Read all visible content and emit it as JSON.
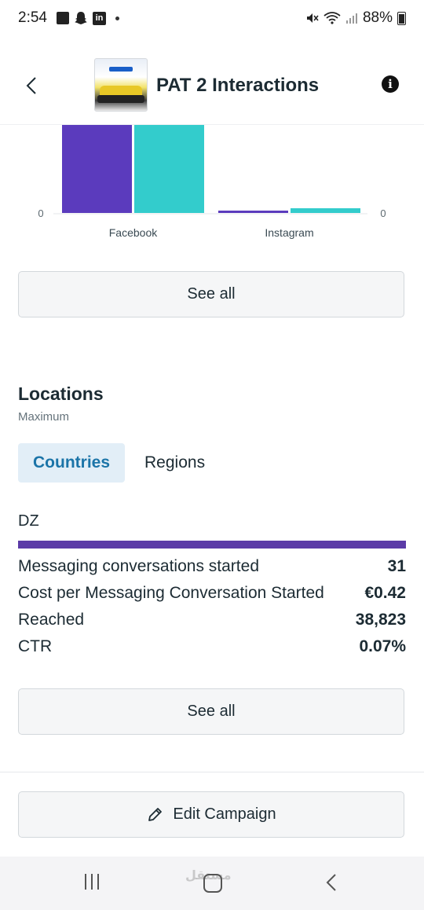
{
  "status_bar": {
    "time": "2:54",
    "battery": "88%",
    "linkedin_glyph": "in"
  },
  "header": {
    "title": "PAT 2 Interactions",
    "back_icon": "chevron-left-icon",
    "info_icon": "info-icon",
    "info_glyph": "i"
  },
  "chart_data": {
    "type": "bar",
    "categories": [
      "Facebook",
      "Instagram"
    ],
    "series": [
      {
        "color": "#5b3bbd",
        "values": [
          100,
          2
        ]
      },
      {
        "color": "#33cccc",
        "values": [
          100,
          4
        ]
      }
    ],
    "left_axis_label": "0",
    "right_axis_label": "0"
  },
  "see_all_1": "See all",
  "locations": {
    "title": "Locations",
    "subtitle": "Maximum",
    "tabs": [
      {
        "label": "Countries",
        "active": true
      },
      {
        "label": "Regions",
        "active": false
      }
    ],
    "country": "DZ",
    "bar_fraction": 1.0,
    "bar_color": "#5b3ba7",
    "metrics": [
      {
        "label": "Messaging conversations started",
        "value": "31"
      },
      {
        "label": "Cost per Messaging Conversation Started",
        "value": "€0.42"
      },
      {
        "label": "Reached",
        "value": "38,823"
      },
      {
        "label": "CTR",
        "value": "0.07%"
      }
    ]
  },
  "see_all_2": "See all",
  "edit_campaign": {
    "label": "Edit Campaign",
    "icon": "pencil-icon"
  },
  "watermark": "مستقل",
  "colors": {
    "accent": "#1b74a8",
    "tab_active_bg": "#e2eef7",
    "facebook_bar": "#5b3bbd",
    "instagram_bar": "#33cccc"
  }
}
